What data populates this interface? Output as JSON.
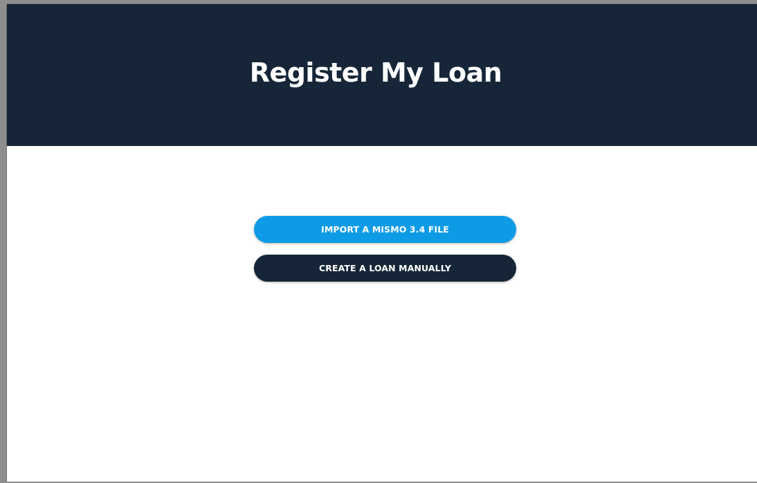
{
  "header": {
    "title": "Register My Loan"
  },
  "actions": {
    "import_label": "IMPORT A MISMO 3.4 FILE",
    "create_label": "CREATE A LOAN MANUALLY"
  },
  "colors": {
    "header_background": "#162638",
    "primary_button": "#0e9be6",
    "secondary_button": "#162638"
  }
}
